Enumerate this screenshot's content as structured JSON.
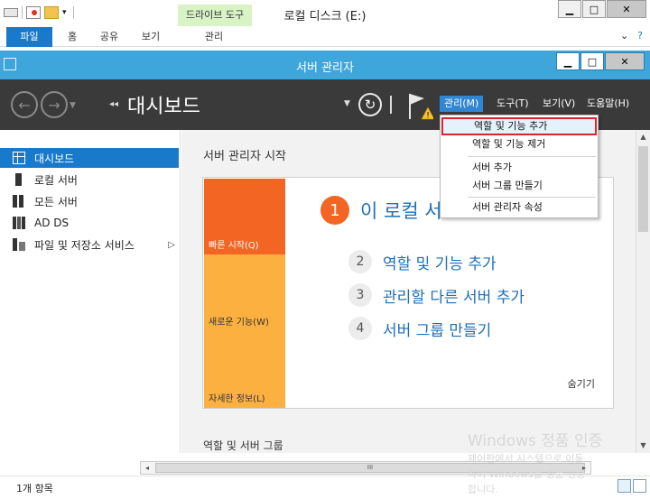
{
  "explorer": {
    "context_tab": "드라이브 도구",
    "title": "로컬 디스크 (E:)",
    "ribbon_tabs": [
      "파일",
      "홈",
      "공유",
      "보기",
      "관리"
    ],
    "status_count": "1개 항목",
    "scroll_grip": "III"
  },
  "server_manager": {
    "title": "서버 관리자",
    "breadcrumb_title": "대시보드",
    "menus": [
      "관리(M)",
      "도구(T)",
      "보기(V)",
      "도움말(H)"
    ],
    "nav_items": [
      {
        "label": "대시보드",
        "selected": true
      },
      {
        "label": "로컬 서버"
      },
      {
        "label": "모든 서버"
      },
      {
        "label": "AD DS"
      },
      {
        "label": "파일 및 저장소 서비스"
      }
    ],
    "section_title": "서버 관리자 시작",
    "tiles": [
      "빠른 시작(Q)",
      "새로운 기능(W)",
      "자세한 정보(L)"
    ],
    "main_step": {
      "num": "1",
      "text": "이 로컬 서"
    },
    "steps": [
      {
        "num": "2",
        "text": "역할 및 기능 추가"
      },
      {
        "num": "3",
        "text": "관리할 다른 서버 추가"
      },
      {
        "num": "4",
        "text": "서버 그룹 만들기"
      }
    ],
    "hide_label": "숨기기",
    "section_title2": "역할 및 서버 그룹"
  },
  "manage_menu": {
    "items": [
      "역할 및 기능 추가",
      "역할 및 기능 제거",
      "서버 추가",
      "서버 그룹 만들기",
      "서버 관리자 속성"
    ],
    "highlighted": 0
  },
  "watermark": {
    "line1": "Windows 정품 인증",
    "line2": "제어판에서 시스템으로 이동",
    "line3": "하여 Windows를 정품 인증",
    "line4": "합니다."
  },
  "colors": {
    "accent_blue": "#1979ca",
    "titlebar_blue": "#3fa6db",
    "toolbar_dark": "#3a3a3a",
    "quickstart_orange": "#f26522",
    "tile_yellow": "#fbb040",
    "highlight_red": "#d9262c"
  }
}
